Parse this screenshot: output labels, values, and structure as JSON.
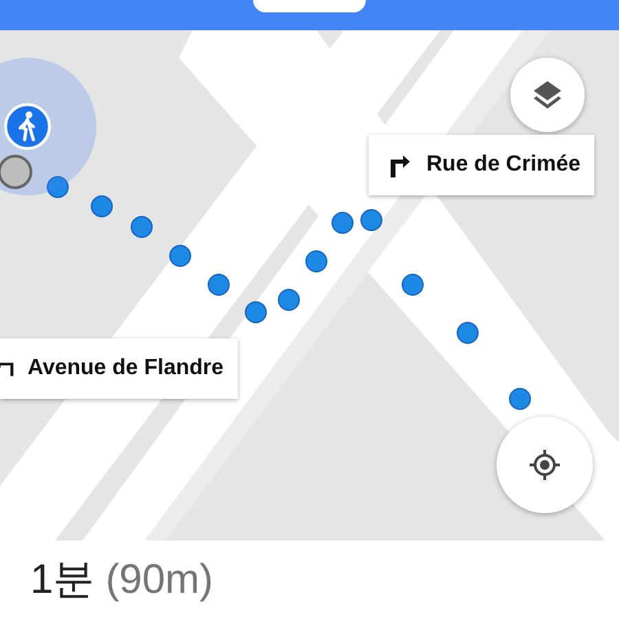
{
  "callouts": [
    {
      "kind": "right",
      "street": "Rue de Crimée"
    },
    {
      "kind": "left",
      "street": "Avenue de Flandre"
    }
  ],
  "summary": {
    "duration": "1분",
    "distance": "(90m)"
  }
}
